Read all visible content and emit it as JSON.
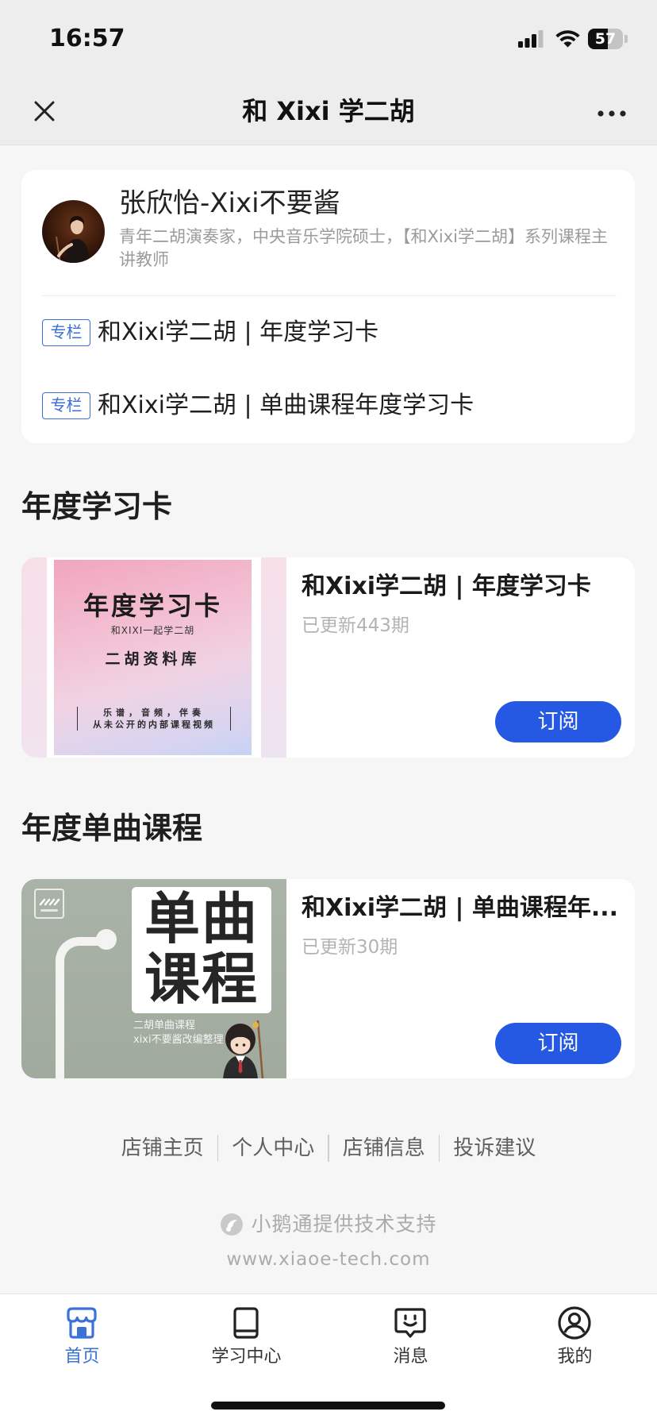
{
  "status_bar": {
    "time": "16:57",
    "battery": "57",
    "icons": [
      "cellular-signal-icon",
      "wifi-icon",
      "battery-icon"
    ]
  },
  "nav": {
    "title": "和 Xixi 学二胡",
    "left_icon": "close-icon",
    "right_icon": "more-icon"
  },
  "author": {
    "name": "张欣怡-Xixi不要酱",
    "description": "青年二胡演奏家，中央音乐学院硕士，【和Xixi学二胡】系列课程主讲教师",
    "columns": [
      {
        "tag": "专栏",
        "title": "和Xixi学二胡 | 年度学习卡"
      },
      {
        "tag": "专栏",
        "title": "和Xixi学二胡 | 单曲课程年度学习卡"
      }
    ]
  },
  "sections": [
    {
      "heading": "年度学习卡",
      "product": {
        "title": "和Xixi学二胡 | 年度学习卡",
        "updates": "已更新443期",
        "button": "订阅",
        "cover": {
          "title": "年度学习卡",
          "subtitle": "和XIXI一起学二胡",
          "caption": "二胡资料库",
          "notes": [
            "乐谱，音频，伴奏",
            "从未公开的内部课程视频"
          ]
        }
      }
    },
    {
      "heading": "年度单曲课程",
      "product": {
        "title": "和Xixi学二胡 | 单曲课程年...",
        "updates": "已更新30期",
        "button": "订阅",
        "cover": {
          "big_lines": [
            "单曲",
            "课程"
          ],
          "captions": [
            "二胡单曲课程",
            "xixi不要酱改编整理"
          ]
        }
      }
    }
  ],
  "footer": {
    "links": [
      "店铺主页",
      "个人中心",
      "店铺信息",
      "投诉建议"
    ],
    "powered_icon": "xiaoe-logo-icon",
    "powered_by": "小鹅通提供技术支持",
    "url": "www.xiaoe-tech.com"
  },
  "tabbar": {
    "items": [
      {
        "label": "首页",
        "icon": "home-icon",
        "active": true
      },
      {
        "label": "学习中心",
        "icon": "book-icon",
        "active": false
      },
      {
        "label": "消息",
        "icon": "chat-icon",
        "active": false
      },
      {
        "label": "我的",
        "icon": "user-icon",
        "active": false
      }
    ]
  },
  "theme": {
    "accent": "#2559e4",
    "tab_active": "#3a72d8",
    "tag_blue": "#3b6fd6"
  }
}
